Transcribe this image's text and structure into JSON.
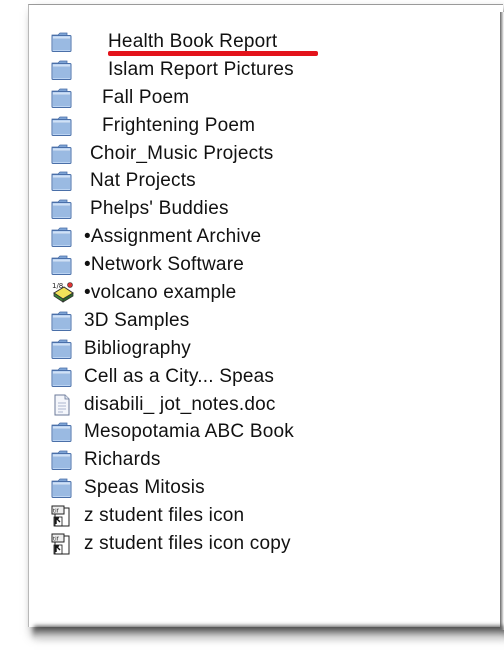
{
  "colors": {
    "folder_light": "#bcd4f2",
    "folder_mid": "#7ea4d6",
    "folder_edge": "#4a6fa8",
    "highlight_underline": "#e3131b"
  },
  "files": [
    {
      "label": "Health Book Report",
      "icon": "folder-icon",
      "indent": 58
    },
    {
      "label": "Islam Report Pictures",
      "icon": "folder-icon",
      "indent": 58
    },
    {
      "label": "Fall Poem",
      "icon": "folder-icon",
      "indent": 52
    },
    {
      "label": "Frightening Poem",
      "icon": "folder-icon",
      "indent": 52
    },
    {
      "label": "Choir_Music Projects",
      "icon": "folder-icon",
      "indent": 40
    },
    {
      "label": "Nat Projects",
      "icon": "folder-icon",
      "indent": 40
    },
    {
      "label": "Phelps' Buddies",
      "icon": "folder-icon",
      "indent": 40
    },
    {
      "label": "•Assignment Archive",
      "icon": "folder-icon",
      "indent": 34
    },
    {
      "label": "•Network Software",
      "icon": "folder-icon",
      "indent": 34
    },
    {
      "label": "•volcano example",
      "icon": "application-icon",
      "indent": 34
    },
    {
      "label": "3D Samples",
      "icon": "folder-icon",
      "indent": 34
    },
    {
      "label": "Bibliography",
      "icon": "folder-icon",
      "indent": 34
    },
    {
      "label": "Cell as a City... Speas",
      "icon": "folder-icon",
      "indent": 34
    },
    {
      "label": "disabili_ jot_notes.doc",
      "icon": "document-icon",
      "indent": 34
    },
    {
      "label": "Mesopotamia ABC Book",
      "icon": "folder-icon",
      "indent": 34
    },
    {
      "label": "Richards",
      "icon": "folder-icon",
      "indent": 34
    },
    {
      "label": "Speas Mitosis",
      "icon": "folder-icon",
      "indent": 34
    },
    {
      "label": "z student files icon",
      "icon": "alias-icon",
      "indent": 34
    },
    {
      "label": "z student files icon copy",
      "icon": "alias-icon",
      "indent": 34
    }
  ]
}
